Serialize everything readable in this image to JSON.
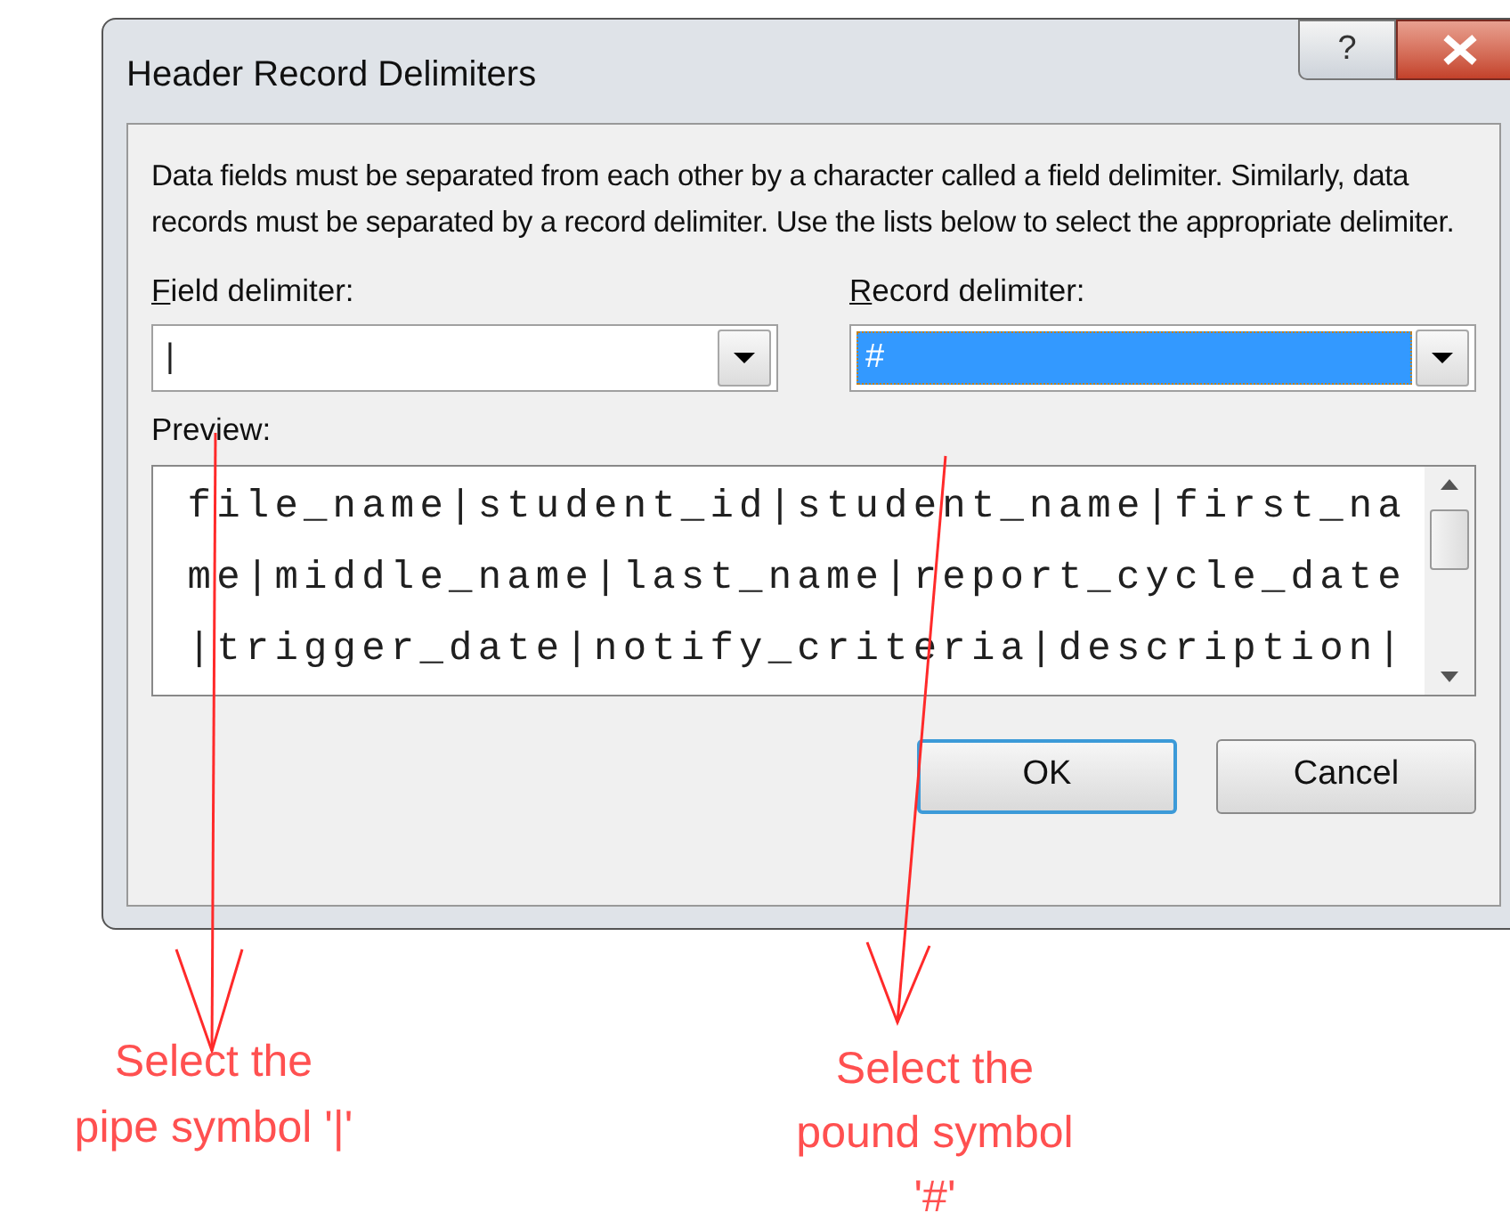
{
  "window": {
    "title": "Header Record Delimiters",
    "help_button": "?"
  },
  "description": "Data fields must be separated from each other by a character called a field delimiter. Similarly, data records must be separated by a record delimiter.  Use the lists below to select the appropriate delimiter.",
  "field_delimiter": {
    "label": "Field delimiter:",
    "value": "|",
    "selected": false
  },
  "record_delimiter": {
    "label": "Record delimiter:",
    "value": "#",
    "selected": true
  },
  "preview": {
    "label": "Preview:",
    "lines": [
      "file_name|student_id|student_name|first_na",
      "me|middle_name|last_name|report_cycle_date",
      "|trigger_date|notify_criteria|description|"
    ]
  },
  "buttons": [
    {
      "label": "OK",
      "default": true
    },
    {
      "label": "Cancel",
      "default": false
    }
  ],
  "annotations": [
    {
      "text": "Select the\npipe symbol '|'"
    },
    {
      "text": "Select the\npound symbol\n'#'"
    }
  ]
}
